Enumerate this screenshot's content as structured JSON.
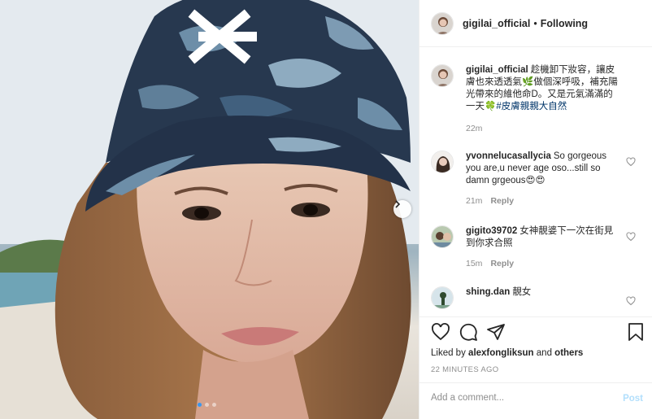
{
  "post": {
    "image_alt": "selfie photo"
  },
  "header": {
    "username": "gigilai_official",
    "separator": "•",
    "follow_status": "Following"
  },
  "caption": {
    "username": "gigilai_official",
    "text": "趁機卸下妝容，讓皮膚也來透透氣🌿做個深呼吸，補充陽光帶來的維他命D。又是元氣滿滿的一天🍀",
    "hashtag": "#皮膚親親大自然",
    "time": "22m"
  },
  "comments": [
    {
      "username": "yvonnelucasallycia",
      "text": "So gorgeous you are,u never age oso...still so damn grgeous😍😍",
      "time": "21m",
      "reply_label": "Reply"
    },
    {
      "username": "gigito39702",
      "text": "女神靚婆下一次在街見到你求合照",
      "time": "15m",
      "reply_label": "Reply"
    },
    {
      "username": "shing.dan",
      "text": "靚女",
      "time": "",
      "reply_label": ""
    }
  ],
  "likes": {
    "prefix": "Liked by",
    "user": "alexfongliksun",
    "and": "and",
    "others": "others"
  },
  "timestamp": "22 MINUTES AGO",
  "add_comment": {
    "placeholder": "Add a comment...",
    "post_label": "Post"
  },
  "carousel": {
    "count": 3,
    "active": 0
  },
  "icons": {
    "like": "heart-icon",
    "comment": "comment-icon",
    "share": "share-icon",
    "save": "bookmark-icon",
    "next": "chevron-right-icon"
  },
  "colors": {
    "link": "#003569",
    "meta": "#8e8e8e",
    "post_disabled": "#b2dffc",
    "dot_active": "#3897f0"
  }
}
